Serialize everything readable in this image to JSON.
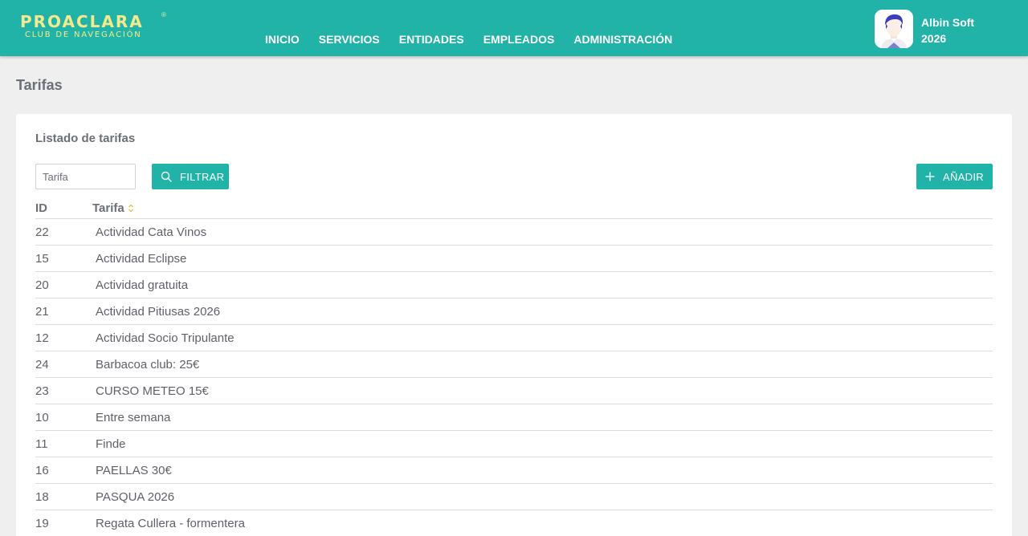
{
  "brand": {
    "name": "PROACLARA",
    "reg": "®",
    "subtitle": "CLUB DE NAVEGACIÓN"
  },
  "nav": [
    {
      "label": "INICIO"
    },
    {
      "label": "SERVICIOS"
    },
    {
      "label": "ENTIDADES"
    },
    {
      "label": "EMPLEADOS"
    },
    {
      "label": "ADMINISTRACIÓN"
    }
  ],
  "user": {
    "name": "Albin Soft",
    "year": "2026"
  },
  "page": {
    "title": "Tarifas"
  },
  "card": {
    "title": "Listado de tarifas"
  },
  "filter": {
    "placeholder": "Tarifa",
    "button_label": "FILTRAR"
  },
  "add_button_label": "AÑADIR",
  "table": {
    "headers": {
      "id": "ID",
      "tarifa": "Tarifa"
    },
    "rows": [
      {
        "id": "22",
        "name": "Actividad Cata Vinos"
      },
      {
        "id": "15",
        "name": "Actividad Eclipse"
      },
      {
        "id": "20",
        "name": "Actividad gratuita"
      },
      {
        "id": "21",
        "name": "Actividad Pitiusas 2026"
      },
      {
        "id": "12",
        "name": "Actividad Socio Tripulante"
      },
      {
        "id": "24",
        "name": "Barbacoa club: 25€"
      },
      {
        "id": "23",
        "name": "CURSO METEO 15€"
      },
      {
        "id": "10",
        "name": "Entre semana"
      },
      {
        "id": "11",
        "name": "Finde"
      },
      {
        "id": "16",
        "name": "PAELLAS 30€"
      },
      {
        "id": "18",
        "name": "PASQUA 2026"
      },
      {
        "id": "19",
        "name": "Regata Cullera - formentera"
      }
    ]
  },
  "colors": {
    "primary": "#21b3a8",
    "brand_yellow": "#f4e98d",
    "background": "#efefef"
  },
  "icons": {
    "filter": "search-icon",
    "add": "plus-icon",
    "sort": "sort-icon"
  }
}
